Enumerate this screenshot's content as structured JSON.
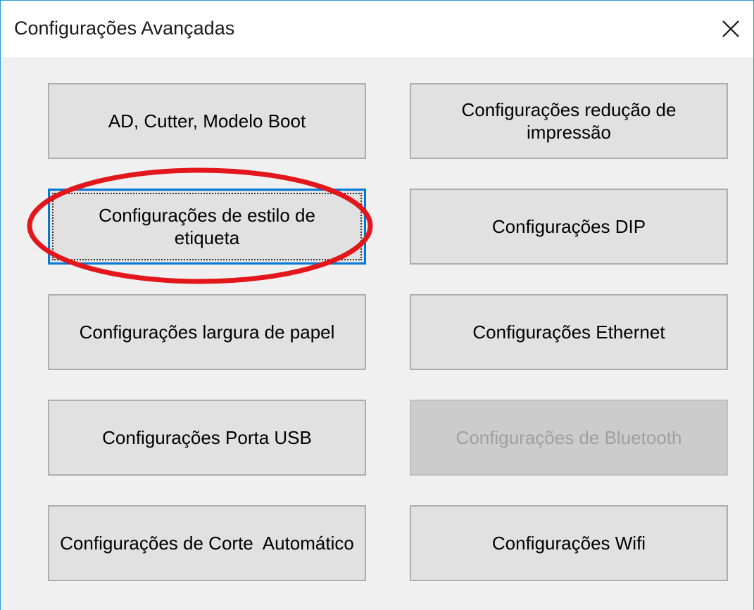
{
  "window": {
    "title": "Configurações Avançadas",
    "close_icon": "close-icon"
  },
  "buttons": {
    "ad_cutter": "AD, Cutter, Modelo Boot",
    "reducao": "Configurações redução de impressão",
    "estilo_etiqueta": "Configurações de estilo de etiqueta",
    "dip": "Configurações DIP",
    "largura_papel": "Configurações largura de papel",
    "ethernet": "Configurações Ethernet",
    "porta_usb": "Configurações Porta USB",
    "bluetooth": "Configurações de Bluetooth",
    "corte_automatico": "Configurações de Corte  Automático",
    "wifi": "Configurações Wifi"
  },
  "annotation": {
    "color": "#e3161b",
    "target": "Configurações de estilo de etiqueta"
  },
  "colors": {
    "window_border": "#2a9bd7",
    "focus_border": "#0078d7",
    "button_bg": "#e1e1e1",
    "disabled_bg": "#cccccc"
  }
}
